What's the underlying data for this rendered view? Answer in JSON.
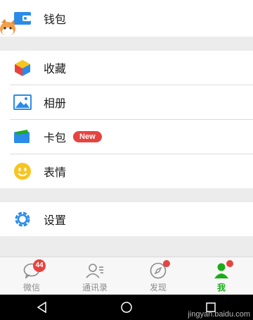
{
  "rows": {
    "wallet": "钱包",
    "favorites": "收藏",
    "album": "相册",
    "card_package": "卡包",
    "card_badge": "New",
    "stickers": "表情",
    "settings": "设置"
  },
  "tabs": [
    {
      "label": "微信",
      "badge": "44",
      "icon": "chat-icon"
    },
    {
      "label": "通讯录",
      "icon": "contacts-icon"
    },
    {
      "label": "发现",
      "icon": "compass-icon"
    },
    {
      "label": "我",
      "icon": "me-icon"
    }
  ],
  "nav": {
    "back": "back-icon",
    "home": "home-icon",
    "recents": "recents-icon"
  },
  "watermark": "jingyan.baidu.com",
  "colors": {
    "accent": "#1aad19",
    "badge": "#e64340",
    "wallet_blue": "#2b8be8"
  }
}
